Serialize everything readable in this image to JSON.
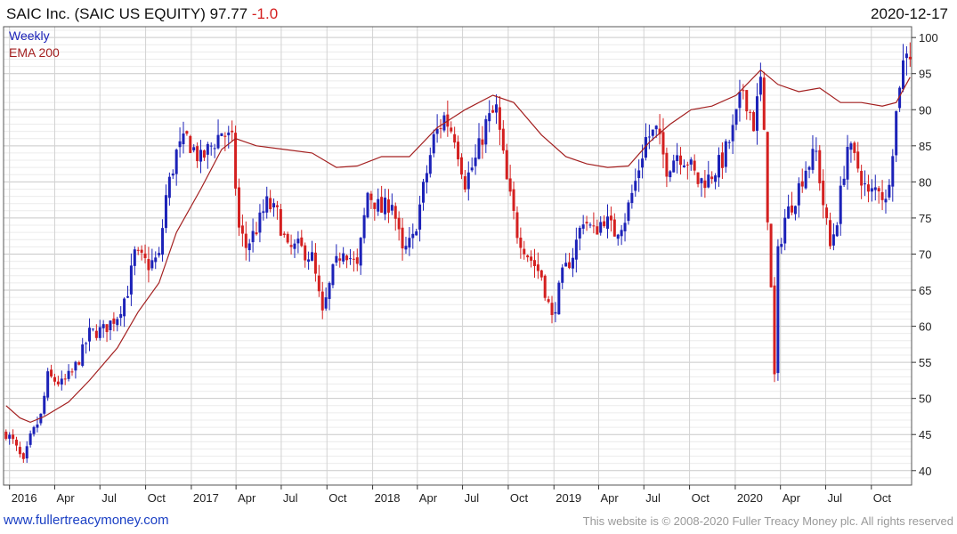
{
  "header": {
    "title": "SAIC Inc. (SAIC US EQUITY) 97.77",
    "change": "-1.0",
    "date": "2020-12-17"
  },
  "footer": {
    "site_link": "www.fullertreacymoney.com",
    "copyright": "This website is © 2008-2020 Fuller Treacy Money plc. All rights reserved"
  },
  "colors": {
    "up": "#1c22b8",
    "down": "#d42020",
    "ema": "#a31f1f",
    "grid": "#d6d6d6",
    "axis": "#333333"
  },
  "chart_data": {
    "type": "candlestick",
    "legend": [
      "Weekly",
      "EMA 200"
    ],
    "legend_placement": "top-left",
    "y_axis_side": "right",
    "grid": true,
    "ylim": [
      38,
      101.5
    ],
    "yticks": [
      40,
      45,
      50,
      55,
      60,
      65,
      70,
      75,
      80,
      85,
      90,
      95,
      100
    ],
    "xlim": [
      "2015-12-20",
      "2020-12-21"
    ],
    "xticks": [
      {
        "date": "2016-01-01",
        "label": "2016"
      },
      {
        "date": "2016-04-01",
        "label": "Apr"
      },
      {
        "date": "2016-07-01",
        "label": "Jul"
      },
      {
        "date": "2016-10-01",
        "label": "Oct"
      },
      {
        "date": "2017-01-01",
        "label": "2017"
      },
      {
        "date": "2017-04-01",
        "label": "Apr"
      },
      {
        "date": "2017-07-01",
        "label": "Jul"
      },
      {
        "date": "2017-10-01",
        "label": "Oct"
      },
      {
        "date": "2018-01-01",
        "label": "2018"
      },
      {
        "date": "2018-04-01",
        "label": "Apr"
      },
      {
        "date": "2018-07-01",
        "label": "Jul"
      },
      {
        "date": "2018-10-01",
        "label": "Oct"
      },
      {
        "date": "2019-01-01",
        "label": "2019"
      },
      {
        "date": "2019-04-01",
        "label": "Apr"
      },
      {
        "date": "2019-07-01",
        "label": "Jul"
      },
      {
        "date": "2019-10-01",
        "label": "Oct"
      },
      {
        "date": "2020-01-01",
        "label": "2020"
      },
      {
        "date": "2020-04-01",
        "label": "Apr"
      },
      {
        "date": "2020-07-01",
        "label": "Jul"
      },
      {
        "date": "2020-10-01",
        "label": "Oct"
      }
    ],
    "close_path": [
      [
        "2015-12-25",
        45.2
      ],
      [
        "2016-01-08",
        44.0
      ],
      [
        "2016-01-29",
        41.0
      ],
      [
        "2016-02-12",
        44.5
      ],
      [
        "2016-03-04",
        47.5
      ],
      [
        "2016-03-18",
        53.0
      ],
      [
        "2016-04-15",
        52.0
      ],
      [
        "2016-05-06",
        53.5
      ],
      [
        "2016-05-27",
        56.5
      ],
      [
        "2016-06-10",
        59.0
      ],
      [
        "2016-07-08",
        59.5
      ],
      [
        "2016-08-05",
        61.5
      ],
      [
        "2016-08-26",
        65.0
      ],
      [
        "2016-09-09",
        70.0
      ],
      [
        "2016-10-07",
        68.5
      ],
      [
        "2016-10-28",
        69.5
      ],
      [
        "2016-11-11",
        78.0
      ],
      [
        "2016-12-02",
        84.0
      ],
      [
        "2016-12-23",
        86.0
      ],
      [
        "2017-01-20",
        83.0
      ],
      [
        "2017-02-10",
        85.0
      ],
      [
        "2017-03-03",
        87.0
      ],
      [
        "2017-03-24",
        85.5
      ],
      [
        "2017-04-07",
        73.5
      ],
      [
        "2017-04-21",
        71.0
      ],
      [
        "2017-05-12",
        73.5
      ],
      [
        "2017-06-02",
        77.0
      ],
      [
        "2017-06-23",
        75.5
      ],
      [
        "2017-07-14",
        70.5
      ],
      [
        "2017-08-04",
        71.0
      ],
      [
        "2017-09-01",
        69.5
      ],
      [
        "2017-09-22",
        61.5
      ],
      [
        "2017-10-13",
        67.5
      ],
      [
        "2017-11-03",
        71.0
      ],
      [
        "2017-12-01",
        68.0
      ],
      [
        "2017-12-22",
        78.5
      ],
      [
        "2018-01-19",
        76.0
      ],
      [
        "2018-02-09",
        77.5
      ],
      [
        "2018-03-02",
        70.0
      ],
      [
        "2018-03-23",
        72.0
      ],
      [
        "2018-04-13",
        79.0
      ],
      [
        "2018-05-04",
        86.0
      ],
      [
        "2018-05-25",
        89.0
      ],
      [
        "2018-06-15",
        86.5
      ],
      [
        "2018-07-06",
        80.0
      ],
      [
        "2018-07-27",
        83.0
      ],
      [
        "2018-08-17",
        88.0
      ],
      [
        "2018-09-07",
        90.0
      ],
      [
        "2018-09-28",
        80.0
      ],
      [
        "2018-10-19",
        73.0
      ],
      [
        "2018-11-09",
        70.0
      ],
      [
        "2018-12-07",
        67.0
      ],
      [
        "2018-12-28",
        61.0
      ],
      [
        "2019-01-18",
        67.0
      ],
      [
        "2019-02-08",
        70.0
      ],
      [
        "2019-03-01",
        75.0
      ],
      [
        "2019-03-22",
        73.0
      ],
      [
        "2019-04-12",
        75.0
      ],
      [
        "2019-05-03",
        73.0
      ],
      [
        "2019-05-24",
        75.0
      ],
      [
        "2019-06-14",
        80.0
      ],
      [
        "2019-07-05",
        86.0
      ],
      [
        "2019-07-26",
        87.0
      ],
      [
        "2019-08-16",
        82.0
      ],
      [
        "2019-09-06",
        84.0
      ],
      [
        "2019-09-27",
        83.0
      ],
      [
        "2019-10-18",
        80.0
      ],
      [
        "2019-11-08",
        80.5
      ],
      [
        "2019-12-06",
        83.0
      ],
      [
        "2019-12-27",
        87.0
      ],
      [
        "2020-01-17",
        93.0
      ],
      [
        "2020-02-07",
        88.0
      ],
      [
        "2020-02-21",
        94.0
      ],
      [
        "2020-02-28",
        86.0
      ],
      [
        "2020-03-13",
        65.0
      ],
      [
        "2020-03-20",
        53.0
      ],
      [
        "2020-03-27",
        70.0
      ],
      [
        "2020-04-10",
        75.0
      ],
      [
        "2020-05-01",
        78.0
      ],
      [
        "2020-05-22",
        82.0
      ],
      [
        "2020-06-12",
        84.0
      ],
      [
        "2020-06-26",
        77.0
      ],
      [
        "2020-07-10",
        71.0
      ],
      [
        "2020-07-24",
        75.0
      ],
      [
        "2020-08-14",
        85.0
      ],
      [
        "2020-09-04",
        82.0
      ],
      [
        "2020-09-25",
        78.0
      ],
      [
        "2020-10-16",
        79.5
      ],
      [
        "2020-10-30",
        77.0
      ],
      [
        "2020-11-13",
        85.0
      ],
      [
        "2020-11-27",
        94.0
      ],
      [
        "2020-12-11",
        98.7
      ],
      [
        "2020-12-18",
        97.77
      ]
    ],
    "ema_200": [
      [
        "2015-12-25",
        49.0
      ],
      [
        "2016-01-22",
        47.3
      ],
      [
        "2016-02-12",
        46.7
      ],
      [
        "2016-03-11",
        47.5
      ],
      [
        "2016-04-29",
        49.5
      ],
      [
        "2016-06-10",
        52.5
      ],
      [
        "2016-08-05",
        57.0
      ],
      [
        "2016-09-16",
        62.0
      ],
      [
        "2016-10-28",
        66.0
      ],
      [
        "2016-12-02",
        73.0
      ],
      [
        "2017-01-20",
        79.0
      ],
      [
        "2017-03-03",
        84.5
      ],
      [
        "2017-03-31",
        86.0
      ],
      [
        "2017-05-12",
        85.0
      ],
      [
        "2017-07-07",
        84.5
      ],
      [
        "2017-09-01",
        84.0
      ],
      [
        "2017-10-20",
        82.0
      ],
      [
        "2017-12-01",
        82.2
      ],
      [
        "2018-01-19",
        83.5
      ],
      [
        "2018-03-16",
        83.5
      ],
      [
        "2018-05-11",
        87.5
      ],
      [
        "2018-07-06",
        90.0
      ],
      [
        "2018-08-31",
        92.0
      ],
      [
        "2018-10-12",
        91.0
      ],
      [
        "2018-12-07",
        86.5
      ],
      [
        "2019-01-25",
        83.5
      ],
      [
        "2019-03-08",
        82.5
      ],
      [
        "2019-04-19",
        82.0
      ],
      [
        "2019-05-31",
        82.2
      ],
      [
        "2019-07-12",
        85.5
      ],
      [
        "2019-08-23",
        88.0
      ],
      [
        "2019-10-04",
        90.0
      ],
      [
        "2019-11-15",
        90.5
      ],
      [
        "2020-01-03",
        92.0
      ],
      [
        "2020-02-21",
        95.5
      ],
      [
        "2020-03-27",
        93.5
      ],
      [
        "2020-05-08",
        92.5
      ],
      [
        "2020-06-19",
        93.0
      ],
      [
        "2020-07-31",
        91.0
      ],
      [
        "2020-09-11",
        91.0
      ],
      [
        "2020-10-23",
        90.5
      ],
      [
        "2020-11-20",
        91.0
      ],
      [
        "2020-12-18",
        94.5
      ]
    ]
  }
}
